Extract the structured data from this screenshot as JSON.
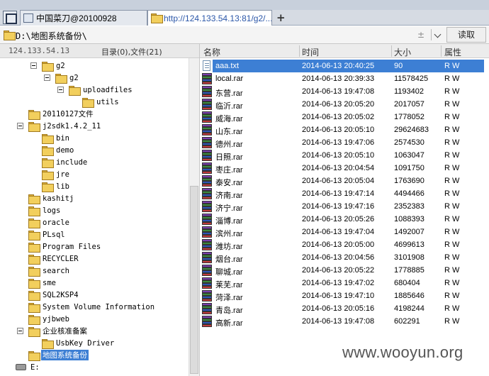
{
  "tabs": [
    {
      "label": "中国菜刀@20100928",
      "active": false
    },
    {
      "label": "http://124.133.54.13:81/g2/...",
      "active": true
    }
  ],
  "address": {
    "path": "D:\\地图系统备份\\",
    "read_label": "读取",
    "ctl_glyph": "±"
  },
  "left_header": {
    "ip": "124.133.54.13",
    "counts": "目录(0),文件(21)"
  },
  "tree": [
    {
      "label": "g2",
      "indent": 1,
      "expanded": true
    },
    {
      "label": "g2",
      "indent": 2,
      "expanded": true
    },
    {
      "label": "uploadfiles",
      "indent": 3,
      "expanded": true
    },
    {
      "label": "utils",
      "indent": 4,
      "expanded": false
    },
    {
      "label": "20110127文件",
      "indent": 0,
      "expanded": false
    },
    {
      "label": "j2sdk1.4.2_11",
      "indent": 0,
      "expanded": true
    },
    {
      "label": "bin",
      "indent": 1,
      "expanded": false
    },
    {
      "label": "demo",
      "indent": 1,
      "expanded": false
    },
    {
      "label": "include",
      "indent": 1,
      "expanded": false
    },
    {
      "label": "jre",
      "indent": 1,
      "expanded": false
    },
    {
      "label": "lib",
      "indent": 1,
      "expanded": false
    },
    {
      "label": "kashitj",
      "indent": 0,
      "expanded": false
    },
    {
      "label": "logs",
      "indent": 0,
      "expanded": false
    },
    {
      "label": "oracle",
      "indent": 0,
      "expanded": false
    },
    {
      "label": "PLsql",
      "indent": 0,
      "expanded": false
    },
    {
      "label": "Program Files",
      "indent": 0,
      "expanded": false
    },
    {
      "label": "RECYCLER",
      "indent": 0,
      "expanded": false
    },
    {
      "label": "search",
      "indent": 0,
      "expanded": false
    },
    {
      "label": "sme",
      "indent": 0,
      "expanded": false
    },
    {
      "label": "SQL2KSP4",
      "indent": 0,
      "expanded": false
    },
    {
      "label": "System Volume Information",
      "indent": 0,
      "expanded": false
    },
    {
      "label": "yjbweb",
      "indent": 0,
      "expanded": false
    },
    {
      "label": "企业核准备案",
      "indent": 0,
      "expanded": true
    },
    {
      "label": "UsbKey Driver",
      "indent": 1,
      "expanded": false
    },
    {
      "label": "地图系统备份",
      "indent": 0,
      "expanded": false,
      "selected": true
    },
    {
      "label": "E:",
      "indent": -1,
      "drive": true
    }
  ],
  "file_columns": {
    "name": "名称",
    "time": "时间",
    "size": "大小",
    "attr": "属性"
  },
  "files": [
    {
      "name": "aaa.txt",
      "time": "2014-06-13 20:40:25",
      "size": "90",
      "attr": "R W",
      "type": "txt",
      "selected": true
    },
    {
      "name": "local.rar",
      "time": "2014-06-13 20:39:33",
      "size": "11578425",
      "attr": "R W",
      "type": "rar"
    },
    {
      "name": "东营.rar",
      "time": "2014-06-13 19:47:08",
      "size": "1193402",
      "attr": "R W",
      "type": "rar"
    },
    {
      "name": "临沂.rar",
      "time": "2014-06-13 20:05:20",
      "size": "2017057",
      "attr": "R W",
      "type": "rar"
    },
    {
      "name": "威海.rar",
      "time": "2014-06-13 20:05:02",
      "size": "1778052",
      "attr": "R W",
      "type": "rar"
    },
    {
      "name": "山东.rar",
      "time": "2014-06-13 20:05:10",
      "size": "29624683",
      "attr": "R W",
      "type": "rar"
    },
    {
      "name": "德州.rar",
      "time": "2014-06-13 19:47:06",
      "size": "2574530",
      "attr": "R W",
      "type": "rar"
    },
    {
      "name": "日照.rar",
      "time": "2014-06-13 20:05:10",
      "size": "1063047",
      "attr": "R W",
      "type": "rar"
    },
    {
      "name": "枣庄.rar",
      "time": "2014-06-13 20:04:54",
      "size": "1091750",
      "attr": "R W",
      "type": "rar"
    },
    {
      "name": "泰安.rar",
      "time": "2014-06-13 20:05:04",
      "size": "1763690",
      "attr": "R W",
      "type": "rar"
    },
    {
      "name": "济南.rar",
      "time": "2014-06-13 19:47:14",
      "size": "4494466",
      "attr": "R W",
      "type": "rar"
    },
    {
      "name": "济宁.rar",
      "time": "2014-06-13 19:47:16",
      "size": "2352383",
      "attr": "R W",
      "type": "rar"
    },
    {
      "name": "淄博.rar",
      "time": "2014-06-13 20:05:26",
      "size": "1088393",
      "attr": "R W",
      "type": "rar"
    },
    {
      "name": "滨州.rar",
      "time": "2014-06-13 19:47:04",
      "size": "1492007",
      "attr": "R W",
      "type": "rar"
    },
    {
      "name": "潍坊.rar",
      "time": "2014-06-13 20:05:00",
      "size": "4699613",
      "attr": "R W",
      "type": "rar"
    },
    {
      "name": "烟台.rar",
      "time": "2014-06-13 20:04:56",
      "size": "3101908",
      "attr": "R W",
      "type": "rar"
    },
    {
      "name": "聊城.rar",
      "time": "2014-06-13 20:05:22",
      "size": "1778885",
      "attr": "R W",
      "type": "rar"
    },
    {
      "name": "莱芜.rar",
      "time": "2014-06-13 19:47:02",
      "size": "680404",
      "attr": "R W",
      "type": "rar"
    },
    {
      "name": "菏泽.rar",
      "time": "2014-06-13 19:47:10",
      "size": "1885646",
      "attr": "R W",
      "type": "rar"
    },
    {
      "name": "青岛.rar",
      "time": "2014-06-13 20:05:16",
      "size": "4198244",
      "attr": "R W",
      "type": "rar"
    },
    {
      "name": "高新.rar",
      "time": "2014-06-13 19:47:08",
      "size": "602291",
      "attr": "R W",
      "type": "rar"
    }
  ],
  "watermark": "www.wooyun.org",
  "colors": {
    "selection": "#3d7fd4",
    "link": "#2a56a8",
    "folder": "#f2cf5d"
  }
}
